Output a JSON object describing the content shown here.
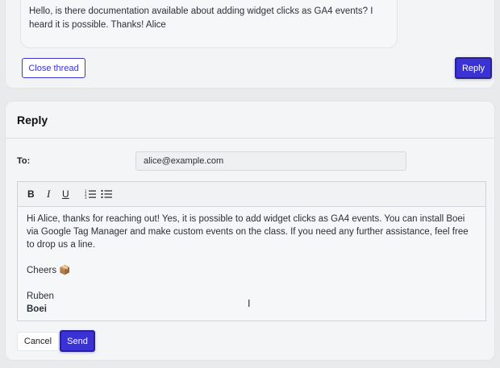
{
  "thread": {
    "message_text": "Hello, is there documentation available about adding widget clicks as GA4 events? I heard it is possible. Thanks! Alice",
    "close_label": "Close thread",
    "reply_label": "Reply"
  },
  "reply_form": {
    "title": "Reply",
    "to_label": "To:",
    "to_value": "alice@example.com",
    "toolbar": {
      "bold": "B",
      "italic": "I",
      "underline": "U",
      "ordered_list": "⒈",
      "bullet_list": "☰"
    },
    "body": {
      "paragraph1": "Hi Alice, thanks for reaching out! Yes, it is possible to add widget clicks as GA4 events. You can install Boei via Google Tag Manager and make custom events on the class. If you need any further assistance, feel free to drop us a line.",
      "sign_off": "Cheers 📦",
      "name": "Ruben",
      "company": "Boei"
    },
    "cancel_label": "Cancel",
    "send_label": "Send"
  },
  "colors": {
    "accent": "#3b32d6",
    "background": "#e9eaec"
  }
}
